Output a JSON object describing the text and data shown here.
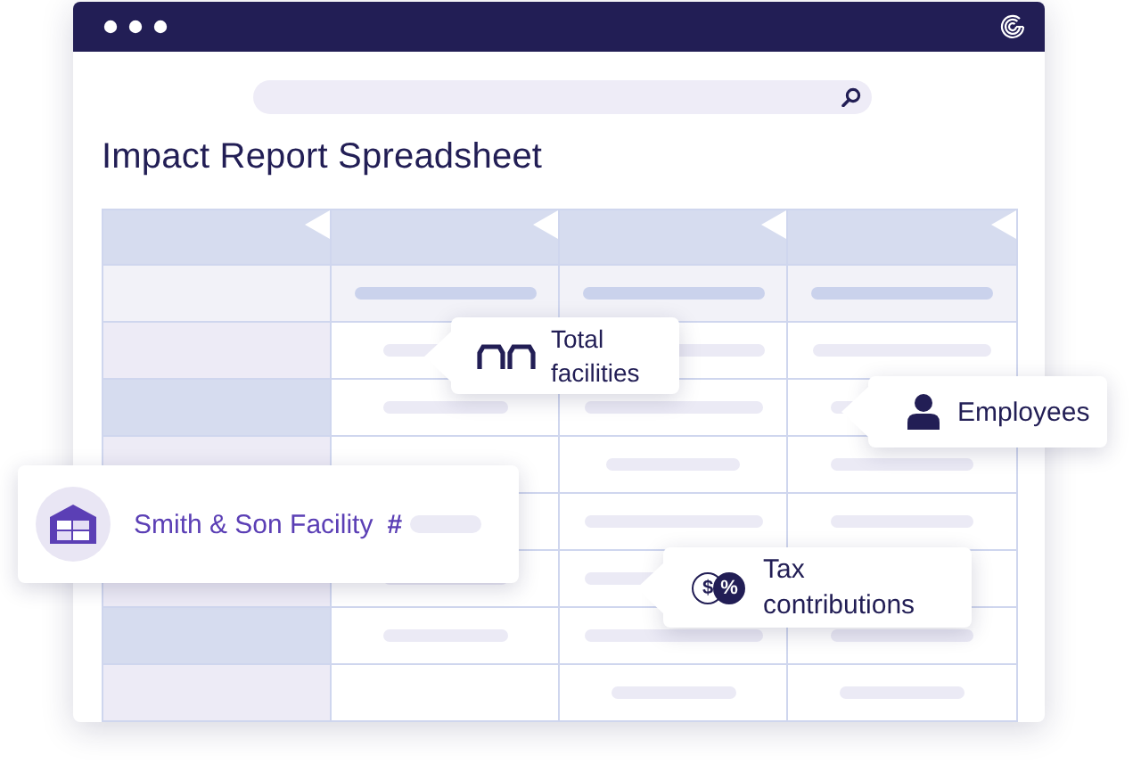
{
  "title": "Impact Report Spreadsheet",
  "callouts": [
    {
      "kind": "facilities",
      "label": "Total facilities"
    },
    {
      "kind": "employees",
      "label": "Employees"
    },
    {
      "kind": "facility",
      "label": "Smith & Son Facility",
      "suffix": "#"
    },
    {
      "kind": "tax",
      "label": "Tax contributions",
      "icon_glyphs": [
        "$",
        "%"
      ]
    }
  ]
}
